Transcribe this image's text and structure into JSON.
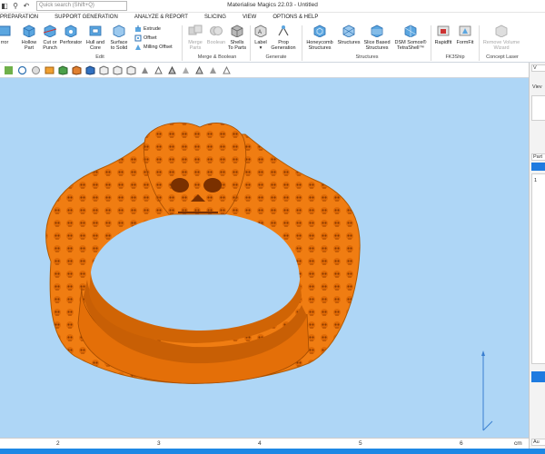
{
  "titlebar": {
    "app_title": "Materialise Magics 22.03 - Untitled",
    "search_placeholder": "Quick search (Shift+Q)"
  },
  "tabs": [
    "PREPARATION",
    "SUPPORT GENERATION",
    "ANALYZE & REPORT",
    "SLICING",
    "VIEW",
    "OPTIONS & HELP"
  ],
  "ribbon": {
    "partial_left": "rror",
    "edit_buttons": [
      {
        "label": "Hollow\nPart",
        "icon": "hollow-part-icon"
      },
      {
        "label": "Cut or\nPunch",
        "icon": "cut-punch-icon"
      },
      {
        "label": "Perforator",
        "icon": "perforator-icon"
      },
      {
        "label": "Hull and\nCore",
        "icon": "hull-core-icon"
      },
      {
        "label": "Surface\nto Solid",
        "icon": "surface-solid-icon"
      }
    ],
    "edit_small": [
      "Extrude",
      "Offset",
      "Milling Offset"
    ],
    "merge_buttons": [
      {
        "label": "Merge\nParts",
        "disabled": true
      },
      {
        "label": "Boolean",
        "disabled": true
      },
      {
        "label": "Shells\nTo Parts",
        "disabled": false
      }
    ],
    "generate_buttons": [
      {
        "label": "Label\n▾"
      },
      {
        "label": "Prop\nGeneration"
      }
    ],
    "structure_buttons": [
      {
        "label": "Honeycomb\nStructures"
      },
      {
        "label": "Structures"
      },
      {
        "label": "Slice Based\nStructures"
      },
      {
        "label": "DSM Somos®\nTetraShell™"
      }
    ],
    "fk_buttons": [
      {
        "label": "Rapidfit"
      },
      {
        "label": "FormFit"
      }
    ],
    "concept_buttons": [
      {
        "label": "Remove Volume\nWizard",
        "disabled": true
      }
    ],
    "groups": {
      "edit": "Edit",
      "merge": "Merge & Boolean",
      "generate": "Generate",
      "structures": "Structures",
      "fk": "FK3Ship",
      "concept": "Concept Laser"
    }
  },
  "ruler": {
    "ticks": [
      "2",
      "3",
      "4",
      "5",
      "6"
    ],
    "unit": "cm"
  },
  "right_panel": {
    "labels": [
      "V",
      "Viev",
      "Part",
      "1",
      "Au"
    ]
  },
  "colors": {
    "viewport_bg": "#aed6f6",
    "model": "#f07d12",
    "status_bar": "#1e88e5"
  }
}
